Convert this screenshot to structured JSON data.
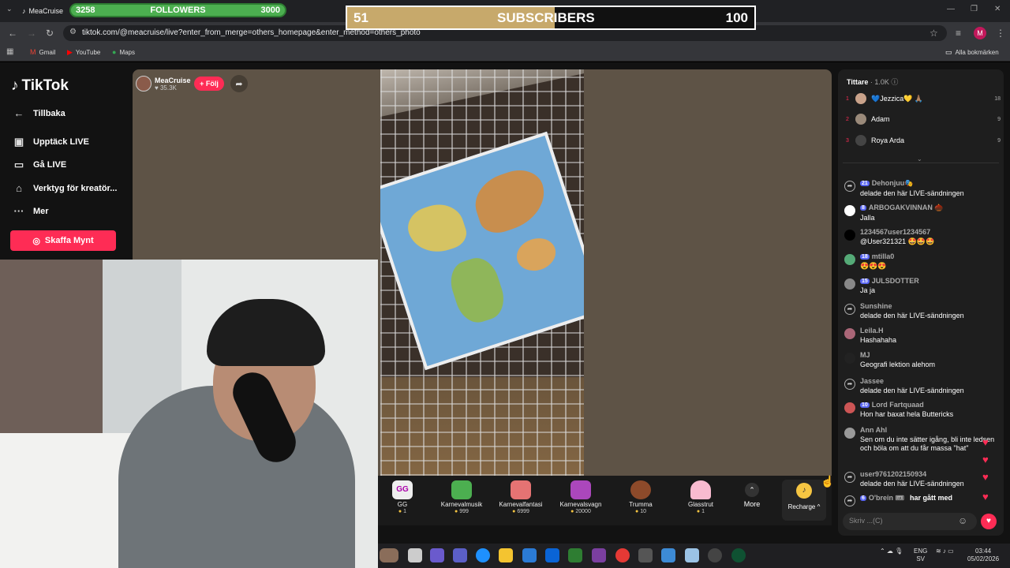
{
  "browser": {
    "tab_title": "MeaCruise",
    "url": "tiktok.com/@meacruise/live?enter_from_merge=others_homepage&enter_method=others_photo",
    "bookmarks": [
      "Gmail",
      "YouTube",
      "Maps"
    ],
    "all_bookmarks": "Alla bokmärken",
    "profile_initial": "M"
  },
  "overlay": {
    "followers": {
      "current": "3258",
      "label": "FOLLOWERS",
      "goal": "3000"
    },
    "subscribers": {
      "current": "51",
      "label": "SUBSCRIBERS",
      "goal": "100",
      "progress": 0.51
    }
  },
  "sidebar": {
    "logo": "TikTok",
    "back": "Tillbaka",
    "items": [
      {
        "label": "Upptäck LIVE",
        "icon": "calendar-live-icon"
      },
      {
        "label": "Gå LIVE",
        "icon": "video-camera-icon"
      },
      {
        "label": "Verktyg för kreatör...",
        "icon": "creator-tools-icon"
      },
      {
        "label": "Mer",
        "icon": "more-dots-icon"
      }
    ],
    "coins_button": "Skaffa Mynt"
  },
  "live": {
    "host_name": "MeaCruise",
    "host_likes": "35.3K",
    "follow_label": "+ Följ"
  },
  "gifts": [
    {
      "name": "GG",
      "price": "1",
      "color": "#e0e0e0"
    },
    {
      "name": "Karnevalmusik",
      "price": "999",
      "color": "#4caf50"
    },
    {
      "name": "Karnevalfantasi",
      "price": "6999",
      "color": "#e57373"
    },
    {
      "name": "Karnevalsvagn",
      "price": "20000",
      "color": "#ab47bc"
    },
    {
      "name": "Trumma",
      "price": "10",
      "color": "#8d4a2a"
    },
    {
      "name": "Glasstrut",
      "price": "1",
      "color": "#f8bbd0"
    }
  ],
  "gifts_more": "More",
  "recharge": "Recharge ^",
  "chat": {
    "viewers_label": "Tittare",
    "viewers_count": "· 1.0K",
    "ranking": [
      {
        "rank": "1",
        "name": "💙Jezzica💛 🙏🏽",
        "score": "18"
      },
      {
        "rank": "2",
        "name": "Adam",
        "score": "9"
      },
      {
        "rank": "3",
        "name": "Roya Arda",
        "score": "9"
      }
    ],
    "messages": [
      {
        "user": "Dehonjuu🎭",
        "level": "21",
        "text": "delade den här LIVE-sändningen",
        "share": true
      },
      {
        "user": "ARBOGAKVINNAN 🌰",
        "level": "8",
        "text": "Jalla",
        "share": false
      },
      {
        "user": "1234567user1234567",
        "level": "",
        "text": "@User321321 🤩🤩🤩",
        "share": false
      },
      {
        "user": "mtilla0",
        "level": "18",
        "text": "😍😍😍",
        "share": false
      },
      {
        "user": "JULSDOTTER",
        "level": "15",
        "text": "Ja ja",
        "share": false
      },
      {
        "user": "Sunshine",
        "level": "",
        "text": "delade den här LIVE-sändningen",
        "share": true
      },
      {
        "user": "Leila.H",
        "level": "",
        "text": "Hashahaha",
        "share": false
      },
      {
        "user": "MJ",
        "level": "",
        "text": "Geografi lektion alehom",
        "share": false
      },
      {
        "user": "Jassee",
        "level": "",
        "text": "delade den här LIVE-sändningen",
        "share": true
      },
      {
        "user": "Lord Fartquaad",
        "level": "10",
        "text": "Hon har baxat hela Buttericks",
        "share": false
      },
      {
        "user": "Ann Ahl",
        "level": "",
        "text": "Sen om du inte sätter igång, bli inte ledsen och böla om att du får massa \"hat\"",
        "share": false
      },
      {
        "user": "user9761202150934",
        "level": "",
        "text": "delade den här LIVE-sändningen",
        "share": true
      },
      {
        "user": "O'brein 🎟",
        "level": "6",
        "text": "har gått med",
        "share": true
      }
    ],
    "input_placeholder": "Skriv ...(C)"
  },
  "taskbar": {
    "language": "ENG",
    "region": "SV",
    "time": "03:44",
    "date": "05/02/2026"
  }
}
